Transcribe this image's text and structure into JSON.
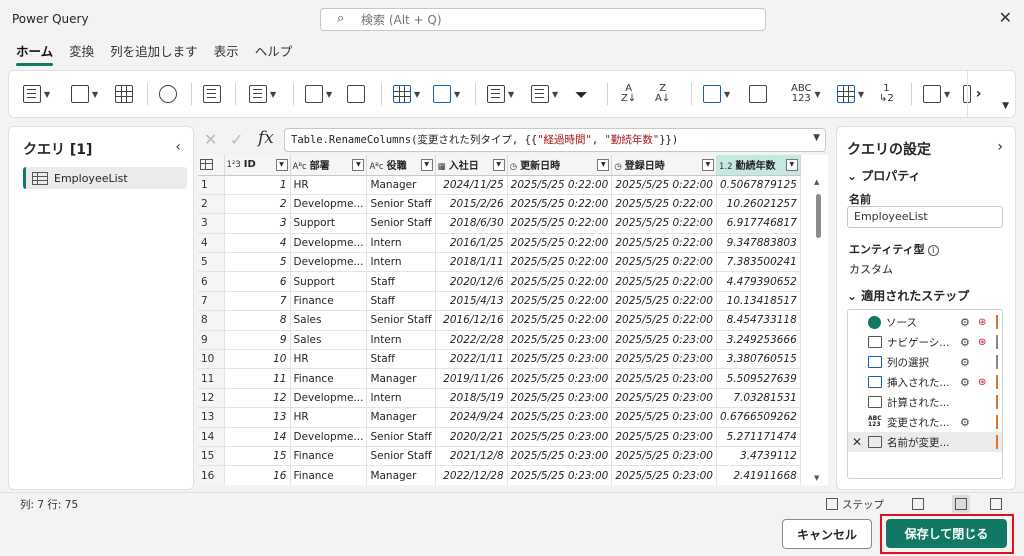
{
  "window": {
    "title": "Power Query"
  },
  "search": {
    "placeholder": "検索 (Alt + Q)"
  },
  "ribbon_tabs": [
    {
      "label": "ホーム",
      "active": true
    },
    {
      "label": "変換"
    },
    {
      "label": "列を追加します"
    },
    {
      "label": "表示"
    },
    {
      "label": "ヘルプ"
    }
  ],
  "toolbar": {
    "abc123_label": "ABC\n123",
    "frac_label": "1\n⁄2"
  },
  "queries_pane": {
    "title": "クエリ [1]",
    "items": [
      {
        "label": "EmployeeList"
      }
    ]
  },
  "formula": {
    "fx": "fx",
    "prefix": "Table.RenameColumns(変更された列タイプ, {{",
    "str1": "\"経過時間\"",
    "sep": ", ",
    "str2": "\"勤続年数\"",
    "suffix": "}})"
  },
  "grid": {
    "columns": [
      {
        "type": "1²3",
        "label": "ID"
      },
      {
        "type": "Aᴮc",
        "label": "部署"
      },
      {
        "type": "Aᴮc",
        "label": "役職"
      },
      {
        "type": "▦",
        "label": "入社日"
      },
      {
        "type": "◷",
        "label": "更新日時"
      },
      {
        "type": "◷",
        "label": "登録日時"
      },
      {
        "type": "1.2",
        "label": "勤続年数"
      }
    ],
    "rows": [
      [
        "1",
        "1",
        "HR",
        "Manager",
        "2024/11/25",
        "2025/5/25 0:22:00",
        "2025/5/25 0:22:00",
        "0.5067879125"
      ],
      [
        "2",
        "2",
        "Developme...",
        "Senior Staff",
        "2015/2/26",
        "2025/5/25 0:22:00",
        "2025/5/25 0:22:00",
        "10.26021257"
      ],
      [
        "3",
        "3",
        "Support",
        "Senior Staff",
        "2018/6/30",
        "2025/5/25 0:22:00",
        "2025/5/25 0:22:00",
        "6.917746817"
      ],
      [
        "4",
        "4",
        "Developme...",
        "Intern",
        "2016/1/25",
        "2025/5/25 0:22:00",
        "2025/5/25 0:22:00",
        "9.347883803"
      ],
      [
        "5",
        "5",
        "Developme...",
        "Intern",
        "2018/1/11",
        "2025/5/25 0:22:00",
        "2025/5/25 0:22:00",
        "7.383500241"
      ],
      [
        "6",
        "6",
        "Support",
        "Staff",
        "2020/12/6",
        "2025/5/25 0:22:00",
        "2025/5/25 0:22:00",
        "4.479390652"
      ],
      [
        "7",
        "7",
        "Finance",
        "Staff",
        "2015/4/13",
        "2025/5/25 0:22:00",
        "2025/5/25 0:22:00",
        "10.13418517"
      ],
      [
        "8",
        "8",
        "Sales",
        "Senior Staff",
        "2016/12/16",
        "2025/5/25 0:22:00",
        "2025/5/25 0:22:00",
        "8.454733118"
      ],
      [
        "9",
        "9",
        "Sales",
        "Intern",
        "2022/2/28",
        "2025/5/25 0:23:00",
        "2025/5/25 0:23:00",
        "3.249253666"
      ],
      [
        "10",
        "10",
        "HR",
        "Staff",
        "2022/1/11",
        "2025/5/25 0:23:00",
        "2025/5/25 0:23:00",
        "3.380760515"
      ],
      [
        "11",
        "11",
        "Finance",
        "Manager",
        "2019/11/26",
        "2025/5/25 0:23:00",
        "2025/5/25 0:23:00",
        "5.509527639"
      ],
      [
        "12",
        "12",
        "Developme...",
        "Intern",
        "2018/5/19",
        "2025/5/25 0:23:00",
        "2025/5/25 0:23:00",
        "7.03281531"
      ],
      [
        "13",
        "13",
        "HR",
        "Manager",
        "2024/9/24",
        "2025/5/25 0:23:00",
        "2025/5/25 0:23:00",
        "0.6766509262"
      ],
      [
        "14",
        "14",
        "Developme...",
        "Senior Staff",
        "2020/2/21",
        "2025/5/25 0:23:00",
        "2025/5/25 0:23:00",
        "5.271171474"
      ],
      [
        "15",
        "15",
        "Finance",
        "Senior Staff",
        "2021/12/8",
        "2025/5/25 0:23:00",
        "2025/5/25 0:23:00",
        "3.4739112"
      ],
      [
        "16",
        "16",
        "Finance",
        "Manager",
        "2022/12/28",
        "2025/5/25 0:23:00",
        "2025/5/25 0:23:00",
        "2.41911668"
      ]
    ]
  },
  "settings_pane": {
    "title": "クエリの設定",
    "properties_header": "プロパティ",
    "name_label": "名前",
    "name_value": "EmployeeList",
    "entity_label": "エンティティ型",
    "entity_value": "カスタム",
    "steps_header": "適用されたステップ",
    "steps": [
      {
        "label": "ソース"
      },
      {
        "label": "ナビゲーシ..."
      },
      {
        "label": "列の選択"
      },
      {
        "label": "挿入された..."
      },
      {
        "label": "計算された..."
      },
      {
        "label": "変更された..."
      },
      {
        "label": "名前が変更..."
      }
    ]
  },
  "status": {
    "text": "列: 7   行: 75",
    "step_label": "ステップ"
  },
  "footer": {
    "cancel_label": "キャンセル",
    "save_label": "保存して閉じる"
  },
  "colors": {
    "accent": "#117865",
    "highlight_border": "#e0101e"
  }
}
